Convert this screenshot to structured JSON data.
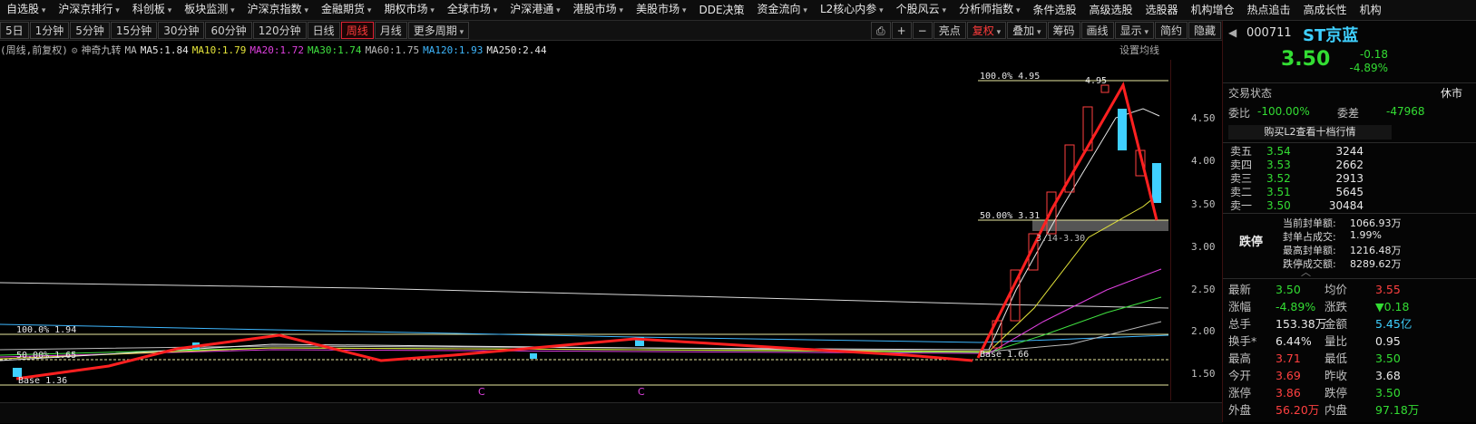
{
  "top_menu": [
    "自选股",
    "沪深京排行",
    "科创板",
    "板块监测",
    "沪深京指数",
    "金融期货",
    "期权市场",
    "全球市场",
    "沪深港通",
    "港股市场",
    "美股市场",
    "DDE决策",
    "资金流向",
    "L2核心内参",
    "个股风云",
    "分析师指数",
    "条件选股",
    "高级选股",
    "选股器",
    "机构增仓",
    "热点追击",
    "高成长性",
    "机构"
  ],
  "toolbar_left": [
    "5日",
    "1分钟",
    "5分钟",
    "15分钟",
    "30分钟",
    "60分钟",
    "120分钟",
    "日线",
    "周线",
    "月线",
    "更多周期"
  ],
  "toolbar_right": [
    "⎙",
    "+",
    "−",
    "亮点",
    "复权",
    "叠加",
    "筹码",
    "画线",
    "显示",
    "简约",
    "隐藏"
  ],
  "ma_row": {
    "period": "(周线,前复权)",
    "indicator": "神奇九转",
    "ma_label": "MA",
    "ma5": "MA5:1.84",
    "ma10": "MA10:1.79",
    "ma20": "MA20:1.72",
    "ma30": "MA30:1.74",
    "ma60": "MA60:1.75",
    "ma120": "MA120:1.93",
    "ma250": "MA250:2.44",
    "settings": "设置均线"
  },
  "chart_annotations": {
    "top_fib": "100.0% 4.95",
    "peak": "4.95",
    "mid_fib": "50.00% 3.31",
    "range": "3.14-3.30",
    "left_fib": "100.0% 1.94",
    "left_mid": "50.00% 1.65",
    "base_left": "Base 1.36",
    "base_right": "Base 1.66",
    "marker": "C"
  },
  "yaxis": [
    "4.50",
    "4.00",
    "3.50",
    "3.00",
    "2.50",
    "2.00",
    "1.50"
  ],
  "stock": {
    "nav": "◀",
    "code": "000711",
    "name": "ST京蓝",
    "price": "3.50",
    "change": "-0.18",
    "change_pct": "-4.89%"
  },
  "status": {
    "label": "交易状态",
    "value": "休市",
    "wei_bi_label": "委比",
    "wei_bi": "-100.00%",
    "wei_cha_label": "委差",
    "wei_cha": "-47968",
    "banner": "购买L2查看十档行情"
  },
  "order_book": [
    {
      "label": "卖五",
      "price": "3.54",
      "vol": "3244"
    },
    {
      "label": "卖四",
      "price": "3.53",
      "vol": "2662"
    },
    {
      "label": "卖三",
      "price": "3.52",
      "vol": "2913"
    },
    {
      "label": "卖二",
      "price": "3.51",
      "vol": "5645"
    },
    {
      "label": "卖一",
      "price": "3.50",
      "vol": "30484"
    }
  ],
  "limit_down": {
    "tag": "跌停",
    "rows": [
      {
        "k": "当前封单额:",
        "v": "1066.93万"
      },
      {
        "k": "封单占成交:",
        "v": "1.99%"
      },
      {
        "k": "最高封单额:",
        "v": "1216.48万"
      },
      {
        "k": "跌停成交额:",
        "v": "8289.62万"
      }
    ]
  },
  "stats": [
    {
      "k1": "最新",
      "v1": "3.50",
      "c1": "g",
      "k2": "均价",
      "v2": "3.55",
      "c2": "r"
    },
    {
      "k1": "涨幅",
      "v1": "-4.89%",
      "c1": "g",
      "k2": "涨跌",
      "v2": "▼0.18",
      "c2": "g"
    },
    {
      "k1": "总手",
      "v1": "153.38万",
      "c1": "w",
      "k2": "金额",
      "v2": "5.45亿",
      "c2": "c"
    },
    {
      "k1": "换手*",
      "v1": "6.44%",
      "c1": "w",
      "k2": "量比",
      "v2": "0.95",
      "c2": "w"
    },
    {
      "k1": "最高",
      "v1": "3.71",
      "c1": "r",
      "k2": "最低",
      "v2": "3.50",
      "c2": "g"
    },
    {
      "k1": "今开",
      "v1": "3.69",
      "c1": "r",
      "k2": "昨收",
      "v2": "3.68",
      "c2": "w"
    },
    {
      "k1": "涨停",
      "v1": "3.86",
      "c1": "r",
      "k2": "跌停",
      "v2": "3.50",
      "c2": "g"
    },
    {
      "k1": "外盘",
      "v1": "56.20万",
      "c1": "r",
      "k2": "内盘",
      "v2": "97.18万",
      "c2": "g"
    }
  ]
}
